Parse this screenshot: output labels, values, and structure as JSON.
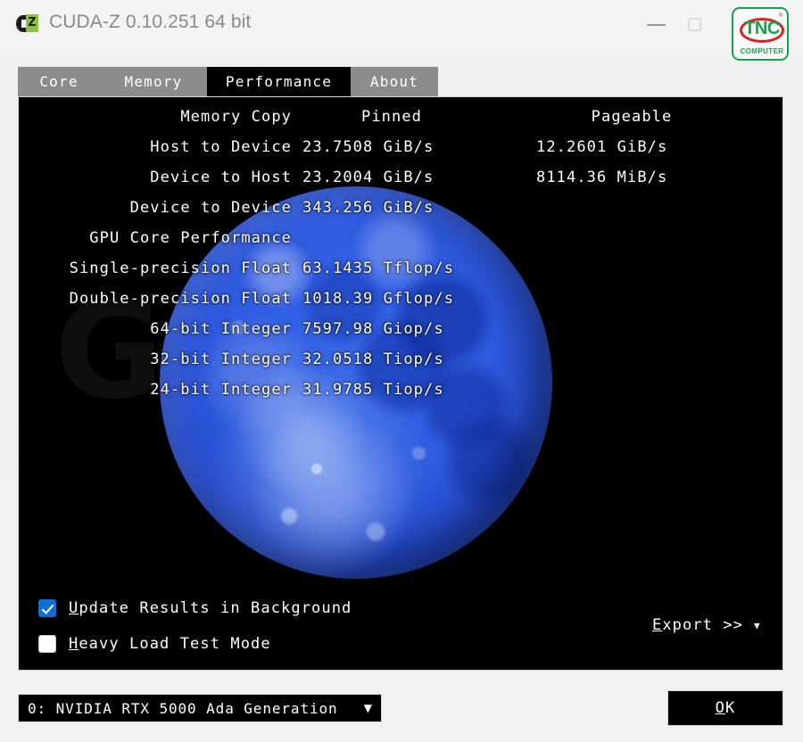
{
  "window": {
    "title": "CUDA-Z 0.10.251 64 bit",
    "icon": "cuda-z-logo",
    "controls": {
      "minimize": "minimize",
      "maximize": "maximize"
    }
  },
  "watermark_logo": {
    "brand": "TNC",
    "subtitle": "COMPUTER",
    "registered": "®",
    "colors": {
      "green": "#15a04a",
      "red": "#e02020"
    }
  },
  "panel_watermark": "GEEK",
  "tabs": [
    {
      "id": "core",
      "label": "Core",
      "active": false
    },
    {
      "id": "memory",
      "label": "Memory",
      "active": false
    },
    {
      "id": "performance",
      "label": "Performance",
      "active": true
    },
    {
      "id": "about",
      "label": "About",
      "active": false
    }
  ],
  "performance": {
    "memory_copy": {
      "section_label": "Memory Copy",
      "column_pinned": "Pinned",
      "column_pageable": "Pageable",
      "rows": [
        {
          "label": "Host to Device",
          "pinned": "23.7508 GiB/s",
          "pageable": "12.2601 GiB/s"
        },
        {
          "label": "Device to Host",
          "pinned": "23.2004 GiB/s",
          "pageable": "8114.36 MiB/s"
        },
        {
          "label": "Device to Device",
          "pinned": "343.256 GiB/s",
          "pageable": ""
        }
      ]
    },
    "gpu_core": {
      "section_label": "GPU Core Performance",
      "rows": [
        {
          "label": "Single-precision Float",
          "value": "63.1435 Tflop/s"
        },
        {
          "label": "Double-precision Float",
          "value": "1018.39 Gflop/s"
        },
        {
          "label": "64-bit Integer",
          "value": "7597.98 Giop/s"
        },
        {
          "label": "32-bit Integer",
          "value": "32.0518 Tiop/s"
        },
        {
          "label": "24-bit Integer",
          "value": "31.9785 Tiop/s"
        }
      ]
    }
  },
  "options": {
    "update_results": {
      "accel": "U",
      "rest": "pdate Results in Background",
      "checked": true
    },
    "heavy_load": {
      "accel": "H",
      "rest": "eavy Load Test Mode",
      "checked": false
    }
  },
  "export": {
    "accel": "E",
    "rest": "xport >>",
    "arrow": "▼"
  },
  "device_select": {
    "value": "0: NVIDIA RTX 5000 Ada Generation",
    "caret": "▼"
  },
  "ok_button": {
    "accel": "O",
    "rest": "K"
  },
  "colors": {
    "tab_inactive_bg": "#8c8c8c",
    "tab_active_bg": "#000000",
    "panel_bg": "#000000",
    "checkbox_checked": "#0a70d8",
    "title_text": "#8a8a8a"
  }
}
